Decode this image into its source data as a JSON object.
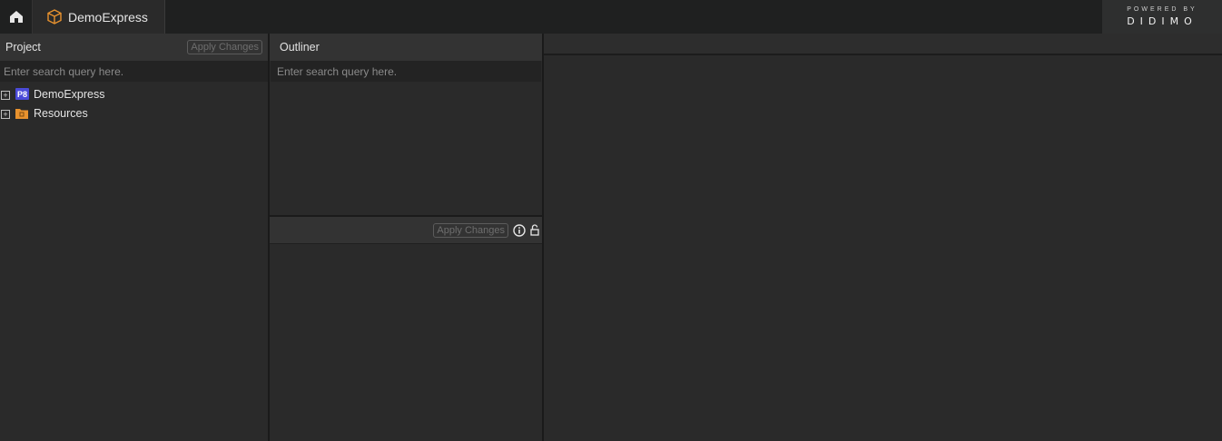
{
  "topbar": {
    "project_tab": "DemoExpress",
    "powered_by": "POWERED BY",
    "brand": "DIDIMO"
  },
  "project_panel": {
    "title": "Project",
    "apply_label": "Apply Changes",
    "search_placeholder": "Enter search query here.",
    "tree": [
      {
        "label": "DemoExpress",
        "icon": "p8-project-icon",
        "icon_text": "P8"
      },
      {
        "label": "Resources",
        "icon": "folder-icon"
      }
    ]
  },
  "outliner_panel": {
    "title": "Outliner",
    "search_placeholder": "Enter search query here."
  },
  "inspector_panel": {
    "apply_label": "Apply Changes"
  },
  "colors": {
    "accent_orange": "#e8922e",
    "p8_blue": "#4b4bd8"
  }
}
